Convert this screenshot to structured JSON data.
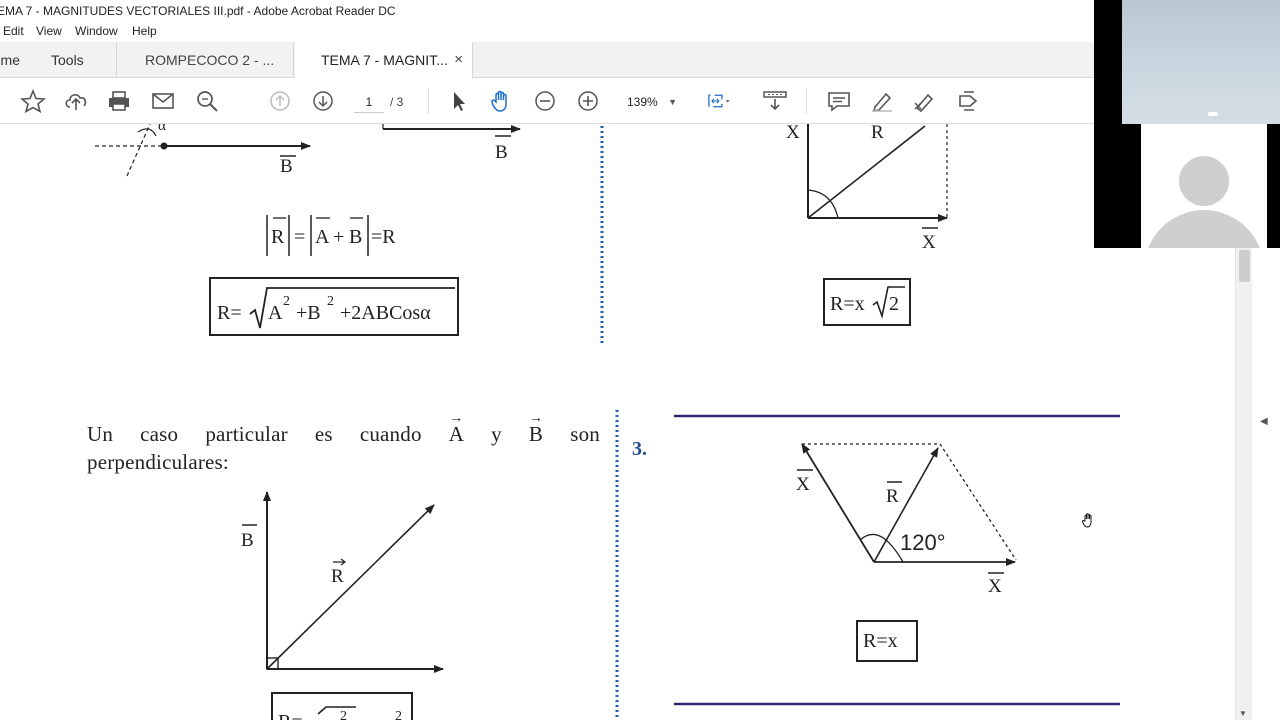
{
  "window": {
    "title": "EMA 7 - MAGNITUDES VECTORIALES III.pdf - Adobe Acrobat Reader DC"
  },
  "menu": {
    "items": [
      "Edit",
      "View",
      "Window",
      "Help"
    ]
  },
  "tabs": {
    "home": "me",
    "tools": "Tools",
    "doc1": "ROMPECOCO 2 - ...",
    "doc2": "TEMA 7 - MAGNIT...",
    "close": "×"
  },
  "toolbar": {
    "page_current": "1",
    "page_total": "/ 3",
    "zoom": "139%",
    "icons": [
      "star-icon",
      "upload-icon",
      "print-icon",
      "email-icon",
      "search-zoom-icon",
      "page-up-icon",
      "page-down-icon",
      "select-pointer-icon",
      "hand-icon",
      "zoom-out-icon",
      "zoom-in-icon",
      "fit-page-icon",
      "scroll-mode-icon",
      "comment-icon",
      "highlight-icon",
      "sign-icon",
      "more-tools-icon"
    ]
  },
  "document": {
    "paragraph": {
      "line1_words": [
        "Un",
        "caso",
        "particular",
        "es",
        "cuando",
        "A",
        "y",
        "B",
        "son"
      ],
      "line2": "perpendiculares:"
    },
    "item_number": "3.",
    "labels": {
      "alpha": "α",
      "B_top_left": "B",
      "B_top_mid": "B",
      "X_top": "X",
      "R_top": "R",
      "X_bottom": "X",
      "eq1_R": "R",
      "eq1_eq1": "=",
      "eq1_A": "A",
      "eq1_plus": "+",
      "eq1_B": "B",
      "eq1_eq2": "=R",
      "eq2_prefix": "R=",
      "eq2_body": "A",
      "eq2_exp1": "2",
      "eq2_mid": "+B",
      "eq2_exp2": "2",
      "eq2_tail": "+2ABCosα",
      "eq3_prefix": "R=x",
      "eq3_root": "2",
      "perp_B": "B",
      "perp_R": "R",
      "p3_X_left": "X",
      "p3_R": "R",
      "p3_angle": "120°",
      "p3_X_bottom": "X",
      "eq4": "R=x",
      "eq5_partial": "R=",
      "eq5_exp": "2",
      "eq5_exp2": "2"
    }
  },
  "colors": {
    "dotted_divider": "#1c5fb0",
    "rule_line": "#2a2a6e",
    "item_number": "#1f4e8c"
  }
}
